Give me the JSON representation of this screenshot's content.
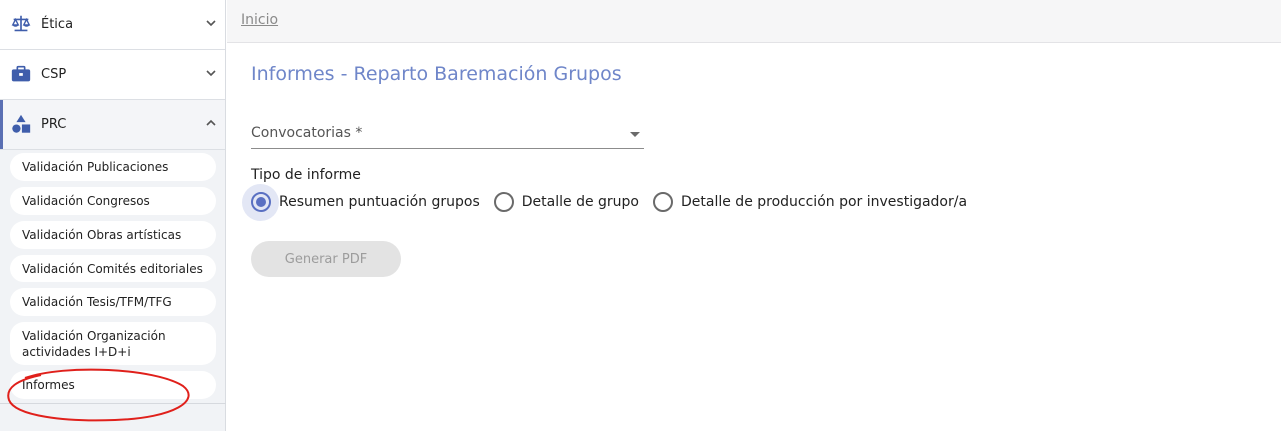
{
  "sidebar": {
    "items": [
      {
        "label": "Ética",
        "icon": "balance-scale-icon",
        "expanded": false
      },
      {
        "label": "CSP",
        "icon": "briefcase-icon",
        "expanded": false
      },
      {
        "label": "PRC",
        "icon": "shapes-icon",
        "expanded": true
      }
    ],
    "submenu": [
      {
        "label": "Validación Publicaciones"
      },
      {
        "label": "Validación Congresos"
      },
      {
        "label": "Validación Obras artísticas"
      },
      {
        "label": "Validación Comités editoriales"
      },
      {
        "label": "Validación Tesis/TFM/TFG"
      },
      {
        "label": "Validación Organización actividades I+D+i"
      },
      {
        "label": "Informes"
      }
    ]
  },
  "breadcrumb": "Inicio",
  "page_title": "Informes - Reparto Baremación Grupos",
  "form": {
    "convocatorias_label": "Convocatorias *",
    "tipo_informe_label": "Tipo de informe",
    "options": [
      {
        "label": "Resumen puntuación grupos",
        "checked": true
      },
      {
        "label": "Detalle de grupo",
        "checked": false
      },
      {
        "label": "Detalle de producción por investigador/a",
        "checked": false
      }
    ],
    "generate_button": "Generar PDF"
  },
  "colors": {
    "accent": "#5a70c2",
    "title": "#6f86c9",
    "annotation": "#e0201b",
    "sidebar_icon": "#3f5dab"
  }
}
